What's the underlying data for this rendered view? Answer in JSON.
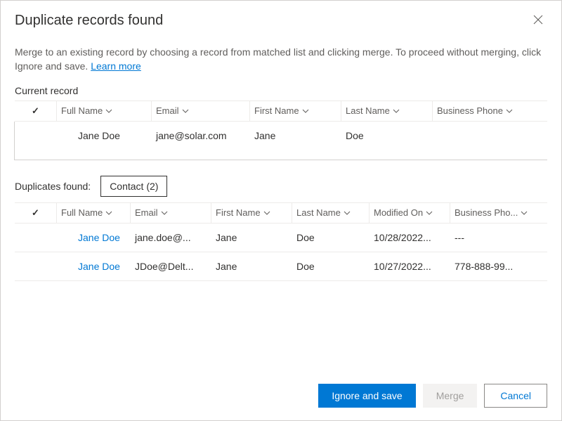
{
  "dialog": {
    "title": "Duplicate records found",
    "instructions": "Merge to an existing record by choosing a record from matched list and clicking merge. To proceed without merging, click Ignore and save. ",
    "learnMore": "Learn more"
  },
  "currentRecord": {
    "label": "Current record",
    "columns": [
      "Full Name",
      "Email",
      "First Name",
      "Last Name",
      "Business Phone"
    ],
    "row": {
      "fullName": "Jane Doe",
      "email": "jane@solar.com",
      "firstName": "Jane",
      "lastName": "Doe",
      "businessPhone": ""
    }
  },
  "duplicates": {
    "label": "Duplicates found:",
    "chip": "Contact (2)",
    "columns": [
      "Full Name",
      "Email",
      "First Name",
      "Last Name",
      "Modified On",
      "Business Pho..."
    ],
    "rows": [
      {
        "fullName": "Jane Doe",
        "email": "jane.doe@...",
        "firstName": "Jane",
        "lastName": "Doe",
        "modifiedOn": "10/28/2022...",
        "businessPhone": "---"
      },
      {
        "fullName": "Jane Doe",
        "email": "JDoe@Delt...",
        "firstName": "Jane",
        "lastName": "Doe",
        "modifiedOn": "10/27/2022...",
        "businessPhone": "778-888-99..."
      }
    ]
  },
  "footer": {
    "ignoreSave": "Ignore and save",
    "merge": "Merge",
    "cancel": "Cancel"
  }
}
